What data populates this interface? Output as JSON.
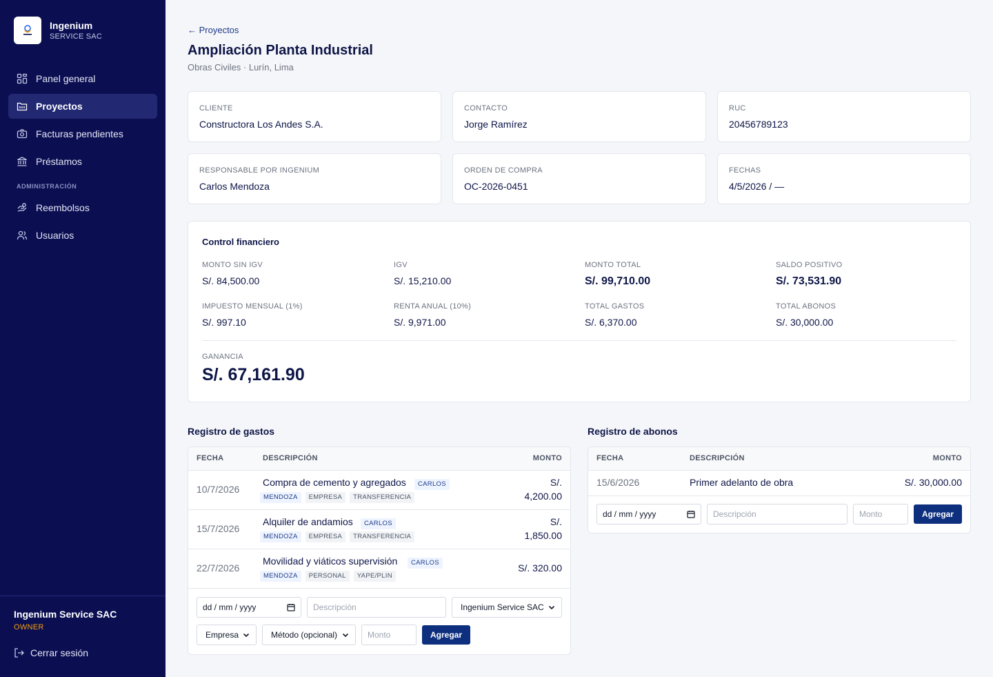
{
  "brand": {
    "name": "Ingenium",
    "subtitle": "SERVICE SAC"
  },
  "nav": {
    "items": [
      {
        "label": "Panel general",
        "icon": "dashboard-icon"
      },
      {
        "label": "Proyectos",
        "icon": "folder-icon",
        "active": true
      },
      {
        "label": "Facturas pendientes",
        "icon": "camera-icon"
      },
      {
        "label": "Préstamos",
        "icon": "bank-icon"
      }
    ],
    "section_label": "ADMINISTRACIÓN",
    "admin_items": [
      {
        "label": "Reembolsos",
        "icon": "refund-icon"
      },
      {
        "label": "Usuarios",
        "icon": "users-icon"
      }
    ]
  },
  "user": {
    "name": "Ingenium Service SAC",
    "role": "OWNER",
    "logout_label": "Cerrar sesión"
  },
  "header": {
    "back_label": "← Proyectos",
    "title": "Ampliación Planta Industrial",
    "subtitle": "Obras Civiles · Lurín, Lima"
  },
  "info_cards": [
    {
      "label": "CLIENTE",
      "value": "Constructora Los Andes S.A."
    },
    {
      "label": "CONTACTO",
      "value": "Jorge Ramírez"
    },
    {
      "label": "RUC",
      "value": "20456789123"
    },
    {
      "label": "RESPONSABLE POR INGENIUM",
      "value": "Carlos Mendoza"
    },
    {
      "label": "ORDEN DE COMPRA",
      "value": "OC-2026-0451"
    },
    {
      "label": "FECHAS",
      "value": "4/5/2026 / —"
    }
  ],
  "finance": {
    "title": "Control financiero",
    "metrics": [
      {
        "label": "MONTO SIN IGV",
        "value": "S/. 84,500.00"
      },
      {
        "label": "IGV",
        "value": "S/. 15,210.00"
      },
      {
        "label": "MONTO TOTAL",
        "value": "S/. 99,710.00"
      },
      {
        "label": "SALDO POSITIVO",
        "value": "S/. 73,531.90"
      },
      {
        "label": "IMPUESTO MENSUAL (1%)",
        "value": "S/. 997.10"
      },
      {
        "label": "RENTA ANUAL (10%)",
        "value": "S/. 9,971.00"
      },
      {
        "label": "TOTAL GASTOS",
        "value": "S/. 6,370.00"
      },
      {
        "label": "TOTAL ABONOS",
        "value": "S/. 30,000.00"
      }
    ],
    "gain_label": "GANANCIA",
    "gain_value": "S/. 67,161.90"
  },
  "expenses": {
    "title": "Registro de gastos",
    "columns": [
      "FECHA",
      "DESCRIPCIÓN",
      "MONTO"
    ],
    "rows": [
      {
        "date": "10/7/2026",
        "desc": "Compra de cemento y agregados",
        "tags": [
          "CARLOS",
          "MENDOZA",
          "EMPRESA",
          "TRANSFERENCIA"
        ],
        "amount_currency": "S/.",
        "amount_value": "4,200.00"
      },
      {
        "date": "15/7/2026",
        "desc": "Alquiler de andamios",
        "tags": [
          "CARLOS",
          "MENDOZA",
          "EMPRESA",
          "TRANSFERENCIA"
        ],
        "amount_currency": "S/.",
        "amount_value": "1,850.00"
      },
      {
        "date": "22/7/2026",
        "desc": "Movilidad y viáticos supervisión",
        "tags": [
          "CARLOS",
          "MENDOZA",
          "PERSONAL",
          "YAPE/PLIN"
        ],
        "amount": "S/. 320.00"
      }
    ],
    "form": {
      "date_placeholder": "dd / mm / yyyy",
      "desc_placeholder": "Descripción",
      "entity_value": "Ingenium Service SAC",
      "type_value": "Empresa",
      "method_value": "Método (opcional)",
      "amount_placeholder": "Monto",
      "submit_label": "Agregar"
    }
  },
  "payments": {
    "title": "Registro de abonos",
    "columns": [
      "FECHA",
      "DESCRIPCIÓN",
      "MONTO"
    ],
    "rows": [
      {
        "date": "15/6/2026",
        "desc": "Primer adelanto de obra",
        "amount": "S/. 30,000.00"
      }
    ],
    "form": {
      "date_placeholder": "dd / mm / yyyy",
      "desc_placeholder": "Descripción",
      "amount_placeholder": "Monto",
      "submit_label": "Agregar"
    }
  },
  "colors": {
    "sidebar": "#0b0f52",
    "accent": "#0d2f7e",
    "role": "#f59e0b"
  }
}
